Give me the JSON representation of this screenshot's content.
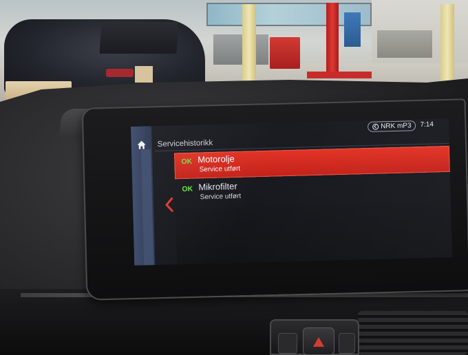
{
  "screen": {
    "title": "Servicehistorikk",
    "status": {
      "radio_source": "NRK mP3",
      "time": "7:14"
    },
    "items": [
      {
        "status": "OK",
        "title": "Motorolje",
        "subtitle": "Service utført",
        "selected": true
      },
      {
        "status": "OK",
        "title": "Mikrofilter",
        "subtitle": "Service utført",
        "selected": false
      }
    ]
  },
  "colors": {
    "selection_red": "#d42a1f",
    "ok_green": "#6fe04a",
    "rail_blue": "#3a4a6a",
    "back_arrow_red": "#e0392c"
  },
  "icons": {
    "home": "home-icon",
    "back": "chevron-left-icon",
    "radio": "radio-icon",
    "hazard": "hazard-triangle-icon"
  }
}
